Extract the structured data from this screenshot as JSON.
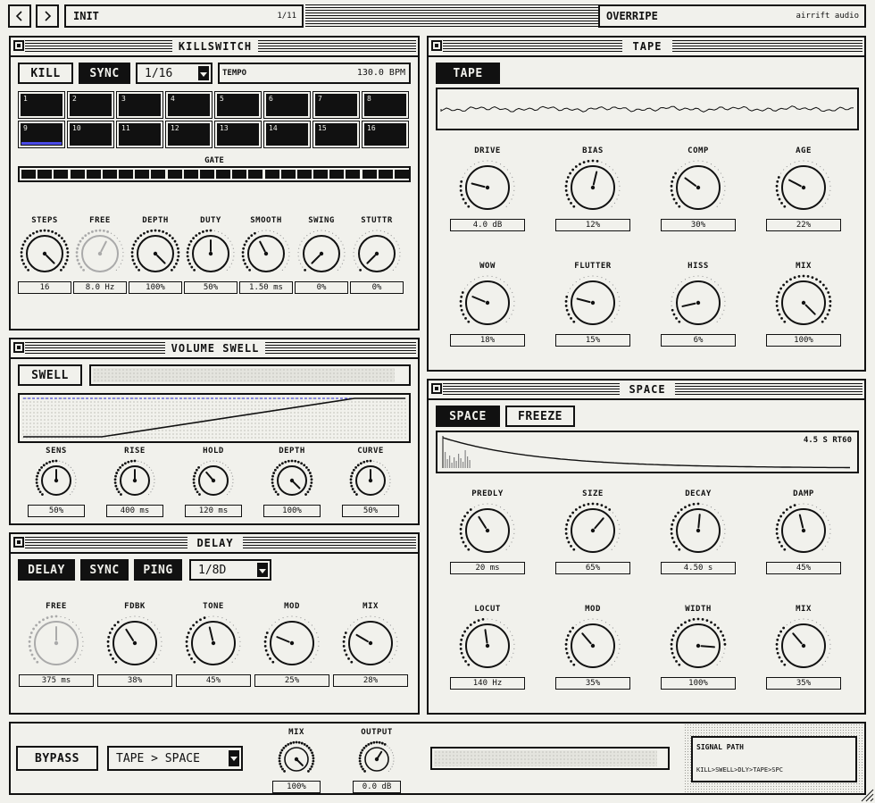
{
  "topbar": {
    "prev_icon": "chevron-left-icon",
    "next_icon": "chevron-right-icon",
    "preset_name": "INIT",
    "preset_index": "1/11",
    "mode_name": "OVERRIPE",
    "brand": "airrift audio"
  },
  "killswitch": {
    "title": "KILLSWITCH",
    "kill_label": "KILL",
    "sync_label": "SYNC",
    "rate_value": "1/16",
    "tempo_label": "TEMPO",
    "tempo_value": "130.0 BPM",
    "steps": [
      "1",
      "2",
      "3",
      "4",
      "5",
      "6",
      "7",
      "8",
      "9",
      "10",
      "11",
      "12",
      "13",
      "14",
      "15",
      "16"
    ],
    "current_step": 9,
    "gate_label": "GATE",
    "gate_segments": 24,
    "knobs": [
      {
        "label": "STEPS",
        "value": "16",
        "level": 1.0,
        "disabled": false
      },
      {
        "label": "FREE",
        "value": "8.0 Hz",
        "level": 0.6,
        "disabled": true
      },
      {
        "label": "DEPTH",
        "value": "100%",
        "level": 1.0,
        "disabled": false
      },
      {
        "label": "DUTY",
        "value": "50%",
        "level": 0.5,
        "disabled": false
      },
      {
        "label": "SMOOTH",
        "value": "1.50 ms",
        "level": 0.4,
        "disabled": false
      },
      {
        "label": "SWING",
        "value": "0%",
        "level": 0.0,
        "disabled": false
      },
      {
        "label": "STUTTR",
        "value": "0%",
        "level": 0.0,
        "disabled": false
      }
    ]
  },
  "swell": {
    "title": "VOLUME SWELL",
    "swell_label": "SWELL",
    "knobs": [
      {
        "label": "SENS",
        "value": "50%",
        "level": 0.5,
        "disabled": false
      },
      {
        "label": "RISE",
        "value": "400 ms",
        "level": 0.5,
        "disabled": false
      },
      {
        "label": "HOLD",
        "value": "120 ms",
        "level": 0.35,
        "disabled": false
      },
      {
        "label": "DEPTH",
        "value": "100%",
        "level": 1.0,
        "disabled": false
      },
      {
        "label": "CURVE",
        "value": "50%",
        "level": 0.5,
        "disabled": false
      }
    ]
  },
  "delay": {
    "title": "DELAY",
    "delay_label": "DELAY",
    "sync_label": "SYNC",
    "ping_label": "PING",
    "rate_value": "1/8D",
    "knobs": [
      {
        "label": "FREE",
        "value": "375 ms",
        "level": 0.5,
        "disabled": true
      },
      {
        "label": "FDBK",
        "value": "38%",
        "level": 0.38,
        "disabled": false
      },
      {
        "label": "TONE",
        "value": "45%",
        "level": 0.45,
        "disabled": false
      },
      {
        "label": "MOD",
        "value": "25%",
        "level": 0.25,
        "disabled": false
      },
      {
        "label": "MIX",
        "value": "28%",
        "level": 0.28,
        "disabled": false
      }
    ]
  },
  "tape": {
    "title": "TAPE",
    "tape_label": "TAPE",
    "knobs": [
      {
        "label": "DRIVE",
        "value": "4.0 dB",
        "level": 0.22,
        "disabled": false
      },
      {
        "label": "BIAS",
        "value": "12%",
        "level": 0.55,
        "disabled": false
      },
      {
        "label": "COMP",
        "value": "30%",
        "level": 0.3,
        "disabled": false
      },
      {
        "label": "AGE",
        "value": "22%",
        "level": 0.27,
        "disabled": false
      },
      {
        "label": "WOW",
        "value": "18%",
        "level": 0.25,
        "disabled": false
      },
      {
        "label": "FLUTTER",
        "value": "15%",
        "level": 0.22,
        "disabled": false
      },
      {
        "label": "HISS",
        "value": "6%",
        "level": 0.12,
        "disabled": false
      },
      {
        "label": "MIX",
        "value": "100%",
        "level": 1.0,
        "disabled": false
      }
    ]
  },
  "space": {
    "title": "SPACE",
    "space_label": "SPACE",
    "freeze_label": "FREEZE",
    "rt_readout": "4.5 S RT60",
    "knobs": [
      {
        "label": "PREDLY",
        "value": "20 ms",
        "level": 0.38,
        "disabled": false
      },
      {
        "label": "SIZE",
        "value": "65%",
        "level": 0.65,
        "disabled": false
      },
      {
        "label": "DECAY",
        "value": "4.50 s",
        "level": 0.52,
        "disabled": false
      },
      {
        "label": "DAMP",
        "value": "45%",
        "level": 0.45,
        "disabled": false
      },
      {
        "label": "LOCUT",
        "value": "140 Hz",
        "level": 0.47,
        "disabled": false
      },
      {
        "label": "MOD",
        "value": "35%",
        "level": 0.35,
        "disabled": false
      },
      {
        "label": "WIDTH",
        "value": "100%",
        "level": 0.85,
        "disabled": false
      },
      {
        "label": "MIX",
        "value": "35%",
        "level": 0.35,
        "disabled": false
      }
    ]
  },
  "footer": {
    "bypass_label": "BYPASS",
    "order_value": "TAPE > SPACE",
    "knobs": [
      {
        "label": "MIX",
        "value": "100%",
        "level": 1.0,
        "disabled": false
      },
      {
        "label": "OUTPUT",
        "value": "0.0 dB",
        "level": 0.62,
        "disabled": false
      }
    ],
    "signal_title": "SIGNAL PATH",
    "signal_chain": "KILL>SWELL>DLY>TAPE>SPC"
  }
}
